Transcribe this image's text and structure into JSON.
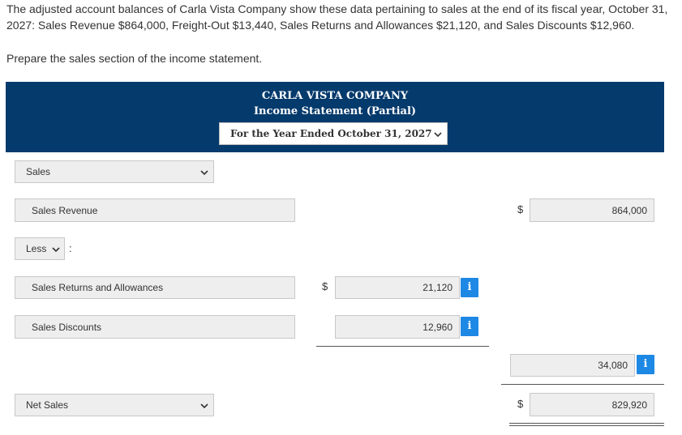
{
  "question": {
    "text": "The adjusted account balances of Carla Vista Company show these data pertaining to sales at the end of its fiscal year, October 31, 2027: Sales Revenue $864,000, Freight-Out $13,440, Sales Returns and Allowances $21,120, and Sales Discounts $12,960.",
    "instruction": "Prepare the sales section of the income statement."
  },
  "statement_header": {
    "company": "CARLA VISTA COMPANY",
    "title": "Income Statement (Partial)",
    "period": "For the Year Ended October 31, 2027"
  },
  "rows": {
    "sales_heading": "Sales",
    "sales_revenue_label": "Sales Revenue",
    "sales_revenue_currency": "$",
    "sales_revenue_value": "864,000",
    "less_select": "Less",
    "less_colon": ":",
    "returns_label": "Sales Returns and Allowances",
    "returns_currency": "$",
    "returns_value": "21,120",
    "discounts_label": "Sales Discounts",
    "discounts_value": "12,960",
    "deductions_total": "34,080",
    "net_sales_label": "Net Sales",
    "net_sales_currency": "$",
    "net_sales_value": "829,920"
  },
  "icons": {
    "info": "i",
    "chevron": "chevron-down-icon"
  },
  "colors": {
    "header_bg": "#053a6c",
    "info_button": "#1e88e5",
    "field_bg": "#eeeeee"
  }
}
